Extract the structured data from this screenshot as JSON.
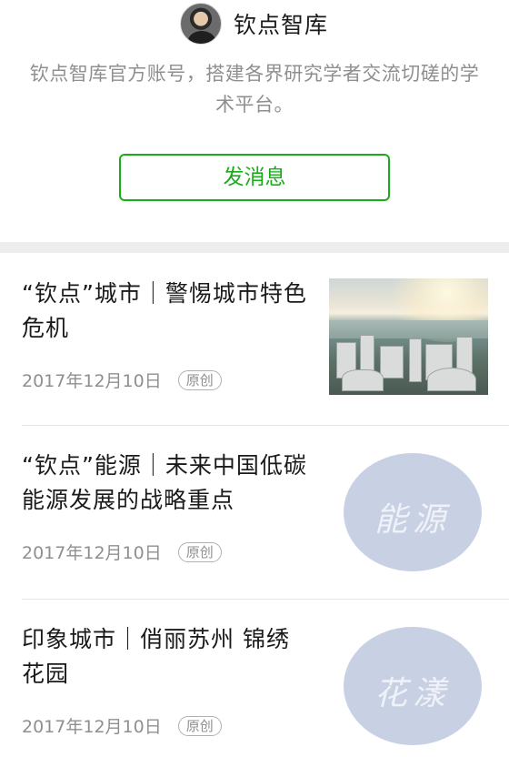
{
  "account": {
    "name": "钦点智库",
    "description": "钦点智库官方账号，搭建各界研究学者交流切磋的学术平台。",
    "send_message_label": "发消息"
  },
  "articles": [
    {
      "title": "“钦点”城市｜警惕城市特色危机",
      "date": "2017年12月10日",
      "badge": "原创",
      "thumbnail": "city-aerial-photo"
    },
    {
      "title": "“钦点”能源｜未来中国低碳能源发展的战略重点",
      "date": "2017年12月10日",
      "badge": "原创",
      "thumbnail": "calligraphy-circle",
      "thumbnail_text": "能源"
    },
    {
      "title": "印象城市｜俏丽苏州 锦绣花园",
      "date": "2017年12月10日",
      "badge": "原创",
      "thumbnail": "calligraphy-circle",
      "thumbnail_text": "花漾"
    }
  ],
  "colors": {
    "accent": "#1aad19",
    "secondary_text": "#8f8f8f",
    "circle_thumb": "#c8d0e4"
  }
}
